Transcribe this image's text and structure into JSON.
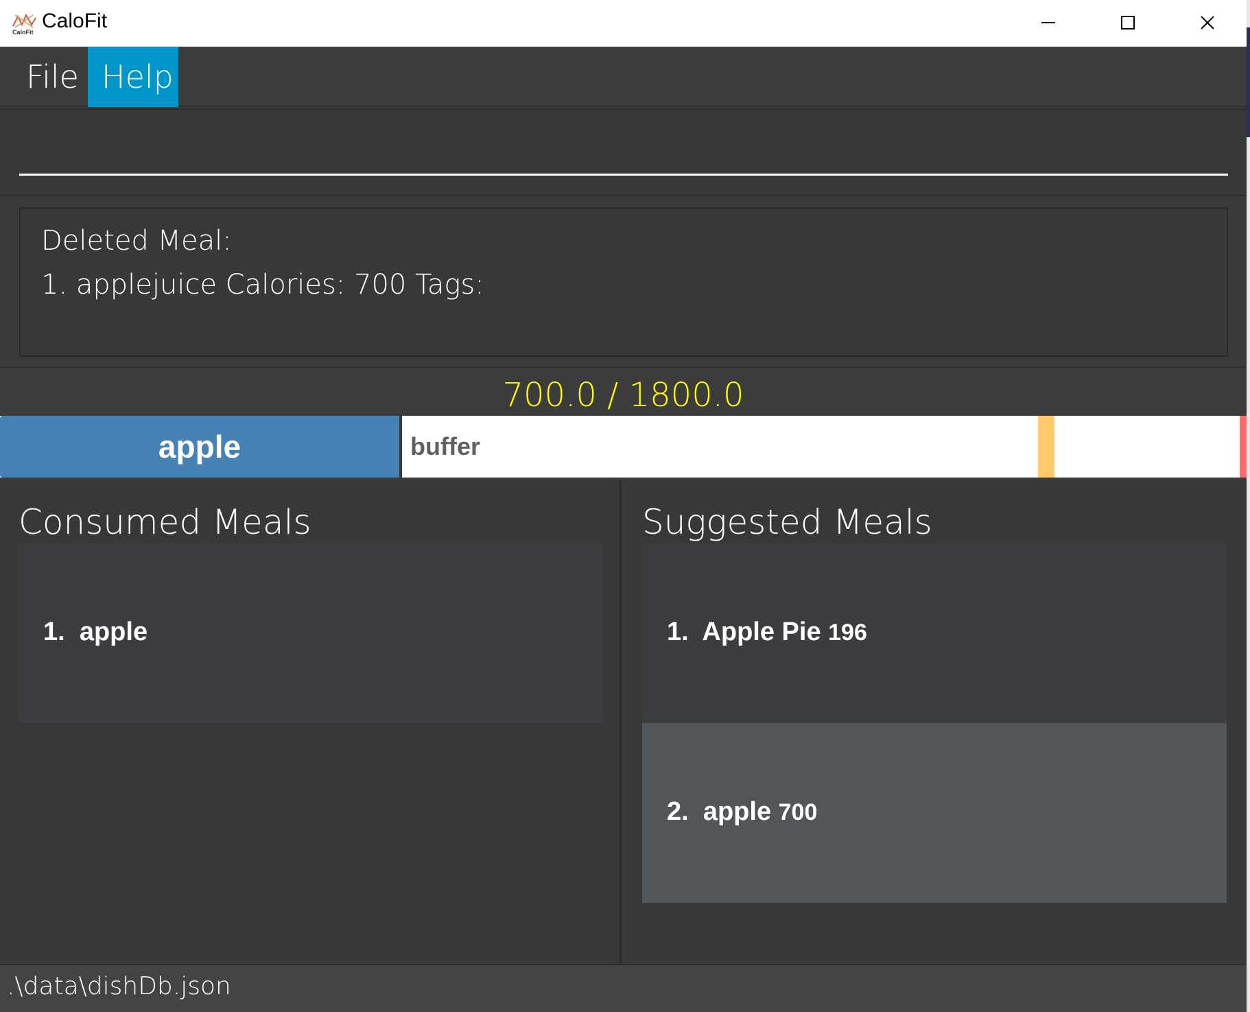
{
  "window": {
    "title": "CaloFit",
    "icon_label": "CaloFit",
    "controls": [
      "minimize",
      "maximize",
      "close"
    ]
  },
  "menu": {
    "file_label": "File",
    "help_label": "Help",
    "help_color": "#0096c9"
  },
  "command": {
    "value": ""
  },
  "result": {
    "line1": "Deleted Meal:",
    "line2": "1. applejuice Calories: 700 Tags:"
  },
  "calorie": {
    "readout": "700.0 / 1800.0",
    "consumed": 700,
    "target": 1800,
    "readout_color": "#ffff00",
    "consumed_label": "apple",
    "consumed_color": "#4682b4",
    "buffer_label": "buffer",
    "warn_color": "#ffc868",
    "limit_color": "#ff6b6b"
  },
  "consumed_meals": {
    "title": "Consumed Meals",
    "items": [
      {
        "index": "1.",
        "name": "apple"
      }
    ]
  },
  "suggested_meals": {
    "title": "Suggested Meals",
    "items": [
      {
        "index": "1.",
        "name": "Apple Pie",
        "calories": "196"
      },
      {
        "index": "2.",
        "name": "apple",
        "calories": "700"
      }
    ]
  },
  "status": {
    "path": ".\\data\\dishDb.json"
  }
}
